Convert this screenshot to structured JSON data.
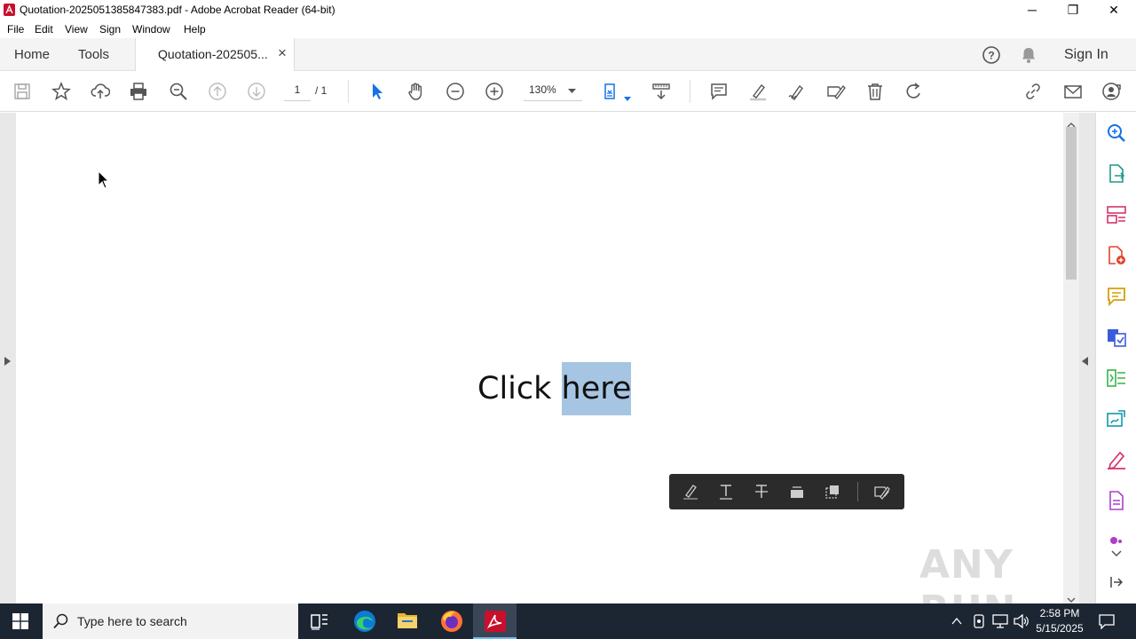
{
  "window": {
    "title": "Quotation-2025051385847383.pdf - Adobe Acrobat Reader (64-bit)",
    "minimize": "─",
    "restore": "❐",
    "close": "✕"
  },
  "menu": [
    "File",
    "Edit",
    "View",
    "Sign",
    "Window",
    "Help"
  ],
  "tabs": {
    "home": "Home",
    "tools": "Tools",
    "document": "Quotation-202505...",
    "close": "×",
    "sign_in": "Sign In"
  },
  "toolbar": {
    "page_current": "1",
    "page_total": "/ 1",
    "zoom": "130%"
  },
  "document": {
    "text_before": "Click ",
    "text_selected": "here"
  },
  "taskbar": {
    "search_placeholder": "Type here to search",
    "time": "2:58 PM",
    "date": "5/15/2025"
  },
  "watermark": "ANY RUN",
  "colors": {
    "accent": "#1473e6",
    "selection": "#a6c5e3",
    "taskbar": "#1c2532",
    "acrobat_red": "#c8102e"
  }
}
